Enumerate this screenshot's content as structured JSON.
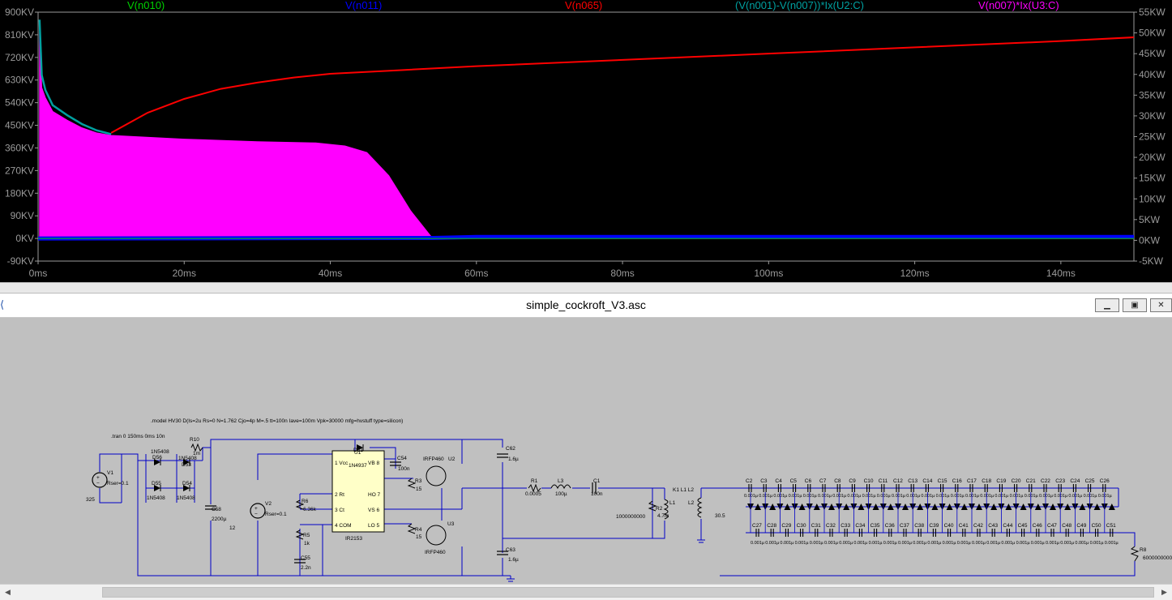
{
  "plot": {
    "traces": [
      {
        "label": "V(n010)",
        "color": "#00d000"
      },
      {
        "label": "V(n011)",
        "color": "#0000ff"
      },
      {
        "label": "V(n065)",
        "color": "#ff0000"
      },
      {
        "label": "(V(n001)-V(n007))*Ix(U2:C)",
        "color": "#00a0a0"
      },
      {
        "label": "V(n007)*Ix(U3:C)",
        "color": "#ff00ff"
      }
    ],
    "left_ticks": [
      "900KV",
      "810KV",
      "720KV",
      "630KV",
      "540KV",
      "450KV",
      "360KV",
      "270KV",
      "180KV",
      "90KV",
      "0KV",
      "-90KV"
    ],
    "right_ticks": [
      "55KW",
      "50KW",
      "45KW",
      "40KW",
      "35KW",
      "30KW",
      "25KW",
      "20KW",
      "15KW",
      "10KW",
      "5KW",
      "0KW",
      "-5KW"
    ],
    "x_ticks": [
      "0ms",
      "20ms",
      "40ms",
      "60ms",
      "80ms",
      "100ms",
      "120ms",
      "140ms"
    ]
  },
  "chart_data": {
    "type": "line",
    "xlabel": "",
    "ylabel": "",
    "xlim": [
      0,
      150
    ],
    "ylim": [
      -90,
      900
    ],
    "y2lim": [
      -5,
      55
    ],
    "series": [
      {
        "name": "V(n065)",
        "axis": "left",
        "color": "#ff0000",
        "x": [
          10,
          15,
          20,
          25,
          30,
          35,
          40,
          50,
          60,
          80,
          100,
          120,
          140,
          150
        ],
        "y": [
          420,
          500,
          555,
          595,
          620,
          640,
          655,
          670,
          685,
          710,
          735,
          760,
          785,
          800
        ]
      },
      {
        "name": "V(n007)*Ix(U3:C)",
        "axis": "left",
        "color": "#ff00ff",
        "x": [
          0.2,
          0.5,
          1,
          2,
          4,
          6,
          8,
          10,
          20,
          30,
          38,
          42,
          45,
          48,
          51,
          54,
          60,
          150
        ],
        "y": [
          820,
          600,
          560,
          505,
          470,
          440,
          420,
          410,
          395,
          385,
          380,
          368,
          342,
          250,
          110,
          0,
          0,
          0
        ]
      },
      {
        "name": "(V(n001)-V(n007))*Ix(U2:C)",
        "axis": "left",
        "color": "#00a0a0",
        "x": [
          0.2,
          0.5,
          1,
          2,
          4,
          6,
          8,
          10
        ],
        "y": [
          870,
          650,
          590,
          530,
          490,
          455,
          430,
          415
        ]
      },
      {
        "name": "V(n011)",
        "axis": "left",
        "color": "#0000ff",
        "x": [
          0,
          54,
          60,
          150
        ],
        "y": [
          0,
          2,
          6,
          6
        ]
      },
      {
        "name": "V(n010)",
        "axis": "left",
        "color": "#00d000",
        "x": [
          0,
          150
        ],
        "y": [
          0,
          0
        ]
      }
    ]
  },
  "window": {
    "title": "simple_cockroft_V3.asc",
    "minimize_icon": "minimize-icon",
    "restore_icon": "restore-icon",
    "close_icon": "close-icon"
  },
  "schematic": {
    "model_directive": ".model HV30 D(Is=2u Rs=0 N=1.762 Cjo=4p M=.5 tt=100n Iave=100m Vpk=30000 mfg=hvstuff type=silicon)",
    "tran_directive": ".tran 0 150ms 0ms 10n",
    "labels": {
      "v1": "V1",
      "v1_rser": "Rser=0.1",
      "v1_val": "325",
      "d56": "D56",
      "d56_part": "1N5408",
      "d53": "D53",
      "d53_part": "1N5408",
      "d55": "D55",
      "d55_part": "1N5408",
      "d54": "D54",
      "d54_part": "1N5408",
      "r10": "R10",
      "r10_val": "1m",
      "c58": "C58",
      "c58_val": "2200µ",
      "c58_v": "12",
      "v2": "V2",
      "v2_rser": "Rser=0.1",
      "r6": "R6",
      "r6_val": "6.36k",
      "r5": "R5",
      "r5_val": "1k",
      "c55": "C55",
      "c55_val": "2.2n",
      "u1": "U1",
      "u1_part": "IR2153",
      "pin1": "1 Vcc",
      "pin2": "2 Rt",
      "pin3": "3 Ct",
      "pin4": "4 COM",
      "pin8": "VB 8",
      "pin7": "HO 7",
      "pin6": "VS 6",
      "pin5": "LO 5",
      "d51": "D51",
      "d51_part": "1N4937",
      "c54": "C54",
      "c54_val": "100n",
      "r3": "R3",
      "r3_val": "15",
      "r4": "R4",
      "r4_val": "15",
      "u2_part": "IRFP460",
      "u2": "U2",
      "u3": "U3",
      "u3_part": "IRFP460",
      "c62": "C62",
      "c62_val": "1.6µ",
      "c63": "C63",
      "c63_val": "1.6µ",
      "r1": "R1",
      "r1_val": "0.0005",
      "l3": "L3",
      "l3_val": "100µ",
      "c1": "C1",
      "c1_val": "100n",
      "r2_val": "1000000000",
      "r2": "R2",
      "r2_val2": "4.7m",
      "l1": "L1",
      "k1": "K1 L1 L2",
      "l2": "L2",
      "l2_val": "30.5",
      "r8": "R8",
      "r8_val": "6000000000"
    },
    "top_caps": [
      "C2",
      "C3",
      "C4",
      "C5",
      "C6",
      "C7",
      "C8",
      "C9",
      "C10",
      "C11",
      "C12",
      "C13",
      "C14",
      "C15",
      "C16",
      "C17",
      "C18",
      "C19",
      "C20",
      "C21",
      "C22",
      "C23",
      "C24",
      "C25",
      "C26"
    ],
    "bottom_caps": [
      "C27",
      "C28",
      "C29",
      "C30",
      "C31",
      "C32",
      "C33",
      "C34",
      "C35",
      "C36",
      "C37",
      "C38",
      "C39",
      "C40",
      "C41",
      "C42",
      "C43",
      "C44",
      "C45",
      "C46",
      "C47",
      "C48",
      "C49",
      "C50",
      "C51"
    ],
    "cap_value": "0.001µ"
  }
}
